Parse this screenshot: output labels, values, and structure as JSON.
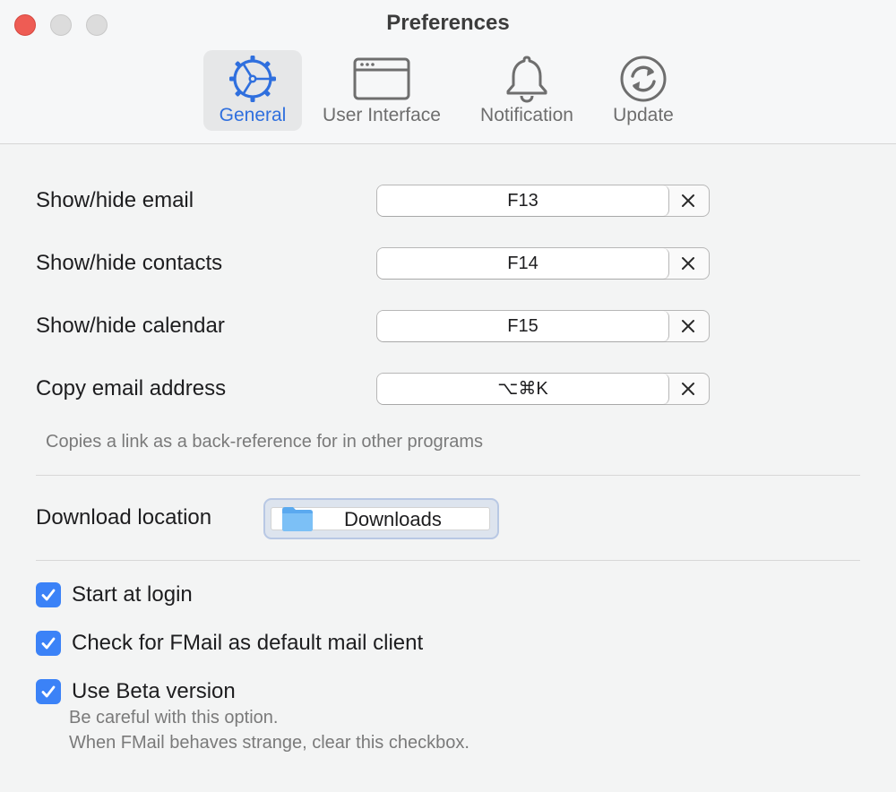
{
  "window": {
    "title": "Preferences"
  },
  "tabs": [
    {
      "label": "General",
      "icon": "gear-icon",
      "active": true
    },
    {
      "label": "User Interface",
      "icon": "window-icon",
      "active": false
    },
    {
      "label": "Notification",
      "icon": "bell-icon",
      "active": false
    },
    {
      "label": "Update",
      "icon": "refresh-icon",
      "active": false
    }
  ],
  "shortcuts": [
    {
      "label": "Show/hide email",
      "key": "F13"
    },
    {
      "label": "Show/hide contacts",
      "key": "F14"
    },
    {
      "label": "Show/hide calendar",
      "key": "F15"
    },
    {
      "label": "Copy email address",
      "key": "⌥⌘K"
    }
  ],
  "shortcut_hint": "Copies a link as a back-reference for in other programs",
  "download": {
    "label": "Download location",
    "folder": "Downloads",
    "folder_icon": "folder-icon"
  },
  "checkboxes": [
    {
      "label": "Start at login",
      "checked": true
    },
    {
      "label": "Check for FMail as default mail client",
      "checked": true
    },
    {
      "label": "Use Beta version",
      "checked": true
    }
  ],
  "beta_hints": [
    "Be careful with this option.",
    "When FMail behaves strange, clear this checkbox."
  ],
  "colors": {
    "accent": "#3b82f7",
    "active_tab_text": "#2f6fde",
    "close_button": "#ee5c54"
  }
}
